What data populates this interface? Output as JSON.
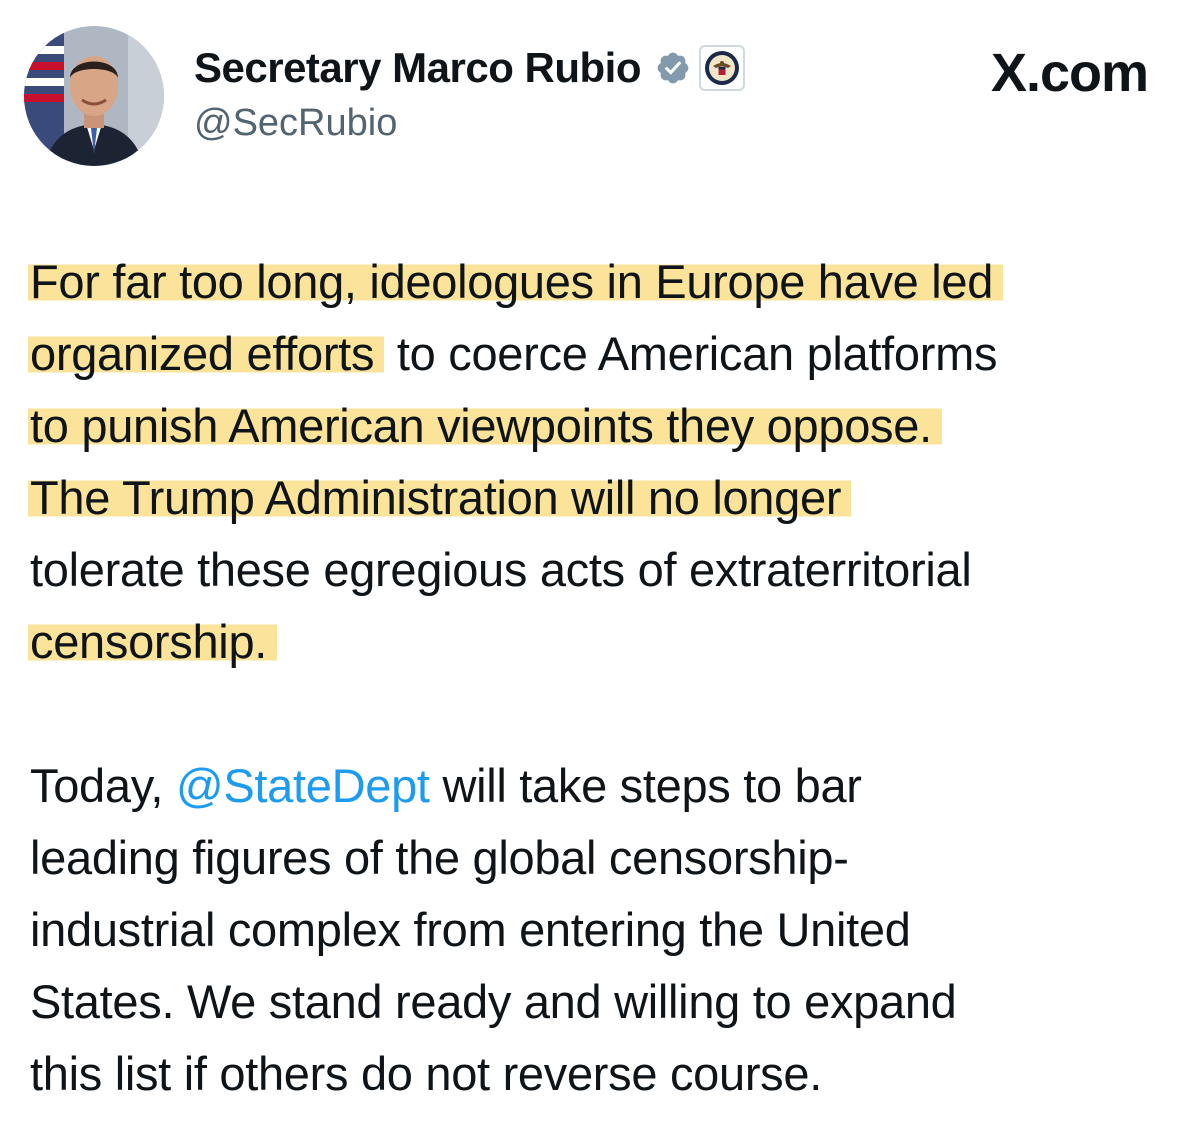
{
  "post": {
    "author": {
      "display_name": "Secretary Marco Rubio",
      "handle": "@SecRubio",
      "avatar_icon": "profile-photo",
      "verified_icon": "verified-badge-icon",
      "affiliation_icon": "state-department-seal-icon"
    },
    "site_label": "X.com",
    "paragraph1": {
      "line1": "For far too long, ideologues in Europe have led",
      "line2_highlight": "organized efforts",
      "line2_rest": " to coerce American platforms",
      "line3": "to punish American viewpoints they oppose.",
      "line4": "The Trump Administration will no longer",
      "line5": "tolerate these egregious acts of extraterritorial",
      "line6": "censorship."
    },
    "paragraph2": {
      "line1_prefix": "Today, ",
      "line1_mention": "@StateDept",
      "line1_suffix": " will take steps to bar",
      "line2": "leading figures of the global censorship-",
      "line3": "industrial complex from entering the United",
      "line4": "States. We stand ready and willing to expand",
      "line5": "this list if others do not reverse course."
    },
    "colors": {
      "highlight": "#fbe49a",
      "mention": "#1d9bf0",
      "verified_badge": "#829aab"
    }
  }
}
